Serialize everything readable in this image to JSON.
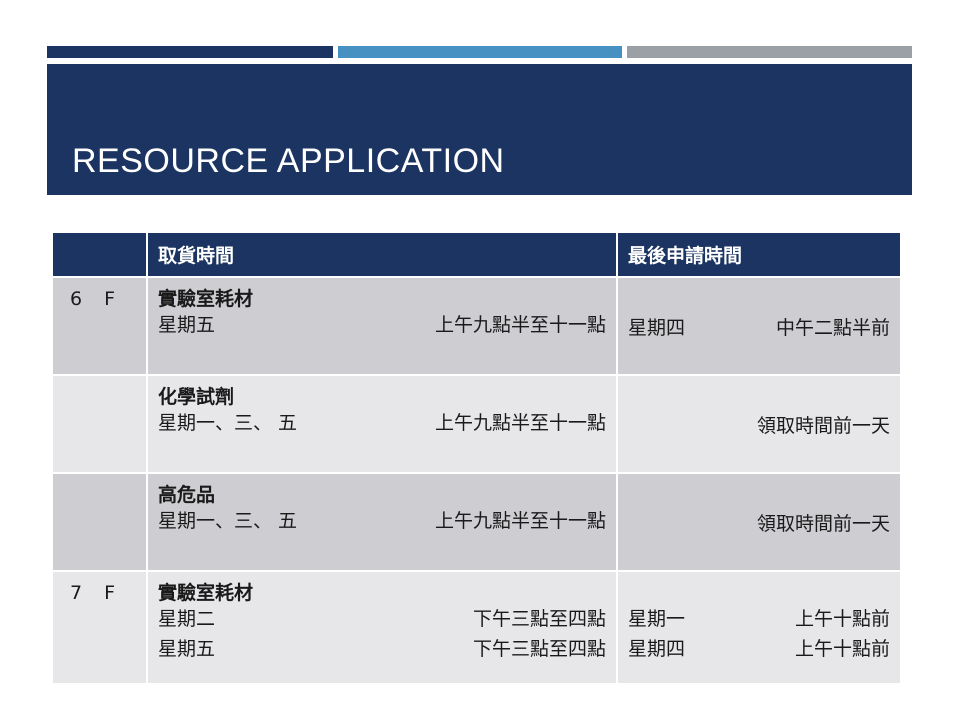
{
  "title": "RESOURCE APPLICATION",
  "colors": {
    "banner": "#1b3461",
    "accent_mid": "#4690c2",
    "accent_gray": "#9aa0a6",
    "row_dark": "#cdcdd2",
    "row_light": "#e7e7ea"
  },
  "table": {
    "headers": [
      "",
      "取貨時間",
      "最後申請時間"
    ],
    "rows": [
      {
        "floor": "6 F",
        "category": "實驗室耗材",
        "lines": [
          {
            "day": "星期五",
            "time": "上午九點半至十一點"
          }
        ],
        "deadline": [
          {
            "day": "星期四",
            "time": "中午二點半前"
          }
        ]
      },
      {
        "floor": "",
        "category": "化學試劑",
        "lines": [
          {
            "day": "星期一、三、 五",
            "time": "上午九點半至十一點"
          }
        ],
        "deadline_text": "領取時間前一天"
      },
      {
        "floor": "",
        "category": "高危品",
        "lines": [
          {
            "day": "星期一、三、 五",
            "time": "上午九點半至十一點"
          }
        ],
        "deadline_text": "領取時間前一天"
      },
      {
        "floor": "7 F",
        "category": "實驗室耗材",
        "lines": [
          {
            "day": "星期二",
            "time": "下午三點至四點"
          },
          {
            "day": "星期五",
            "time": "下午三點至四點"
          }
        ],
        "deadline": [
          {
            "day": "星期一",
            "time": "上午十點前"
          },
          {
            "day": "星期四",
            "time": "上午十點前"
          }
        ]
      }
    ]
  }
}
